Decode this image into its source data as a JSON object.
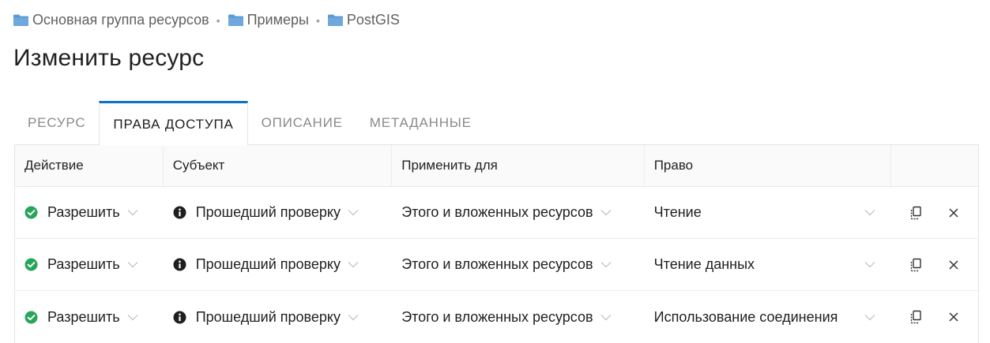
{
  "breadcrumb": {
    "items": [
      {
        "label": "Основная группа ресурсов",
        "icon": "folder-icon"
      },
      {
        "label": "Примеры",
        "icon": "folder-icon"
      },
      {
        "label": "PostGIS",
        "icon": "folder-icon"
      }
    ],
    "separator": "•"
  },
  "page_title": "Изменить ресурс",
  "tabs": [
    {
      "label": "Ресурс",
      "active": false
    },
    {
      "label": "Права доступа",
      "active": true
    },
    {
      "label": "Описание",
      "active": false
    },
    {
      "label": "Метаданные",
      "active": false
    }
  ],
  "table": {
    "columns": {
      "action": "Действие",
      "subject": "Субъект",
      "apply_to": "Применить для",
      "permission": "Право"
    },
    "rows": [
      {
        "action": "Разрешить",
        "subject": "Прошедший проверку",
        "apply_to": "Этого и вложенных ресурсов",
        "permission": "Чтение"
      },
      {
        "action": "Разрешить",
        "subject": "Прошедший проверку",
        "apply_to": "Этого и вложенных ресурсов",
        "permission": "Чтение данных"
      },
      {
        "action": "Разрешить",
        "subject": "Прошедший проверку",
        "apply_to": "Этого и вложенных ресурсов",
        "permission": "Использование соединения"
      }
    ]
  },
  "colors": {
    "accent": "#0b72c5",
    "allow_green": "#27a55a",
    "folder_blue": "#5b9bd5"
  }
}
